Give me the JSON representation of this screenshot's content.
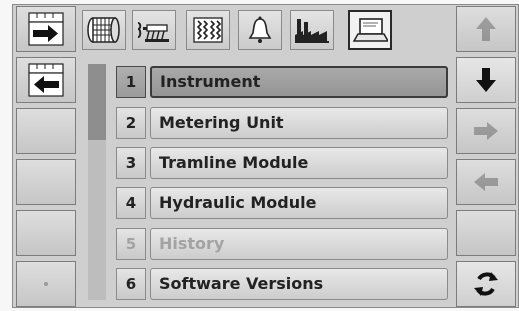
{
  "tabs": [
    {
      "icon": "drum-icon"
    },
    {
      "icon": "seed-drill-icon"
    },
    {
      "icon": "tramline-icon"
    },
    {
      "icon": "alarm-bell-icon"
    },
    {
      "icon": "factory-icon"
    },
    {
      "icon": "laptop-icon",
      "selected": true
    }
  ],
  "left_buttons": [
    {
      "icon": "enter-arrow-icon"
    },
    {
      "icon": "exit-arrow-icon"
    },
    {
      "icon": ""
    },
    {
      "icon": ""
    },
    {
      "icon": ""
    },
    {
      "icon": "dot-icon"
    }
  ],
  "right_buttons": [
    {
      "icon": "arrow-up-icon",
      "enabled": false
    },
    {
      "icon": "arrow-down-icon",
      "enabled": true
    },
    {
      "icon": "arrow-right-icon",
      "enabled": false
    },
    {
      "icon": "arrow-left-icon",
      "enabled": false
    },
    {
      "icon": ""
    },
    {
      "icon": "refresh-icon",
      "enabled": true
    }
  ],
  "menu": [
    {
      "num": "1",
      "label": "Instrument",
      "selected": true
    },
    {
      "num": "2",
      "label": "Metering Unit"
    },
    {
      "num": "3",
      "label": "Tramline Module"
    },
    {
      "num": "4",
      "label": "Hydraulic Module"
    },
    {
      "num": "5",
      "label": "History",
      "disabled": true
    },
    {
      "num": "6",
      "label": "Software Versions"
    }
  ]
}
